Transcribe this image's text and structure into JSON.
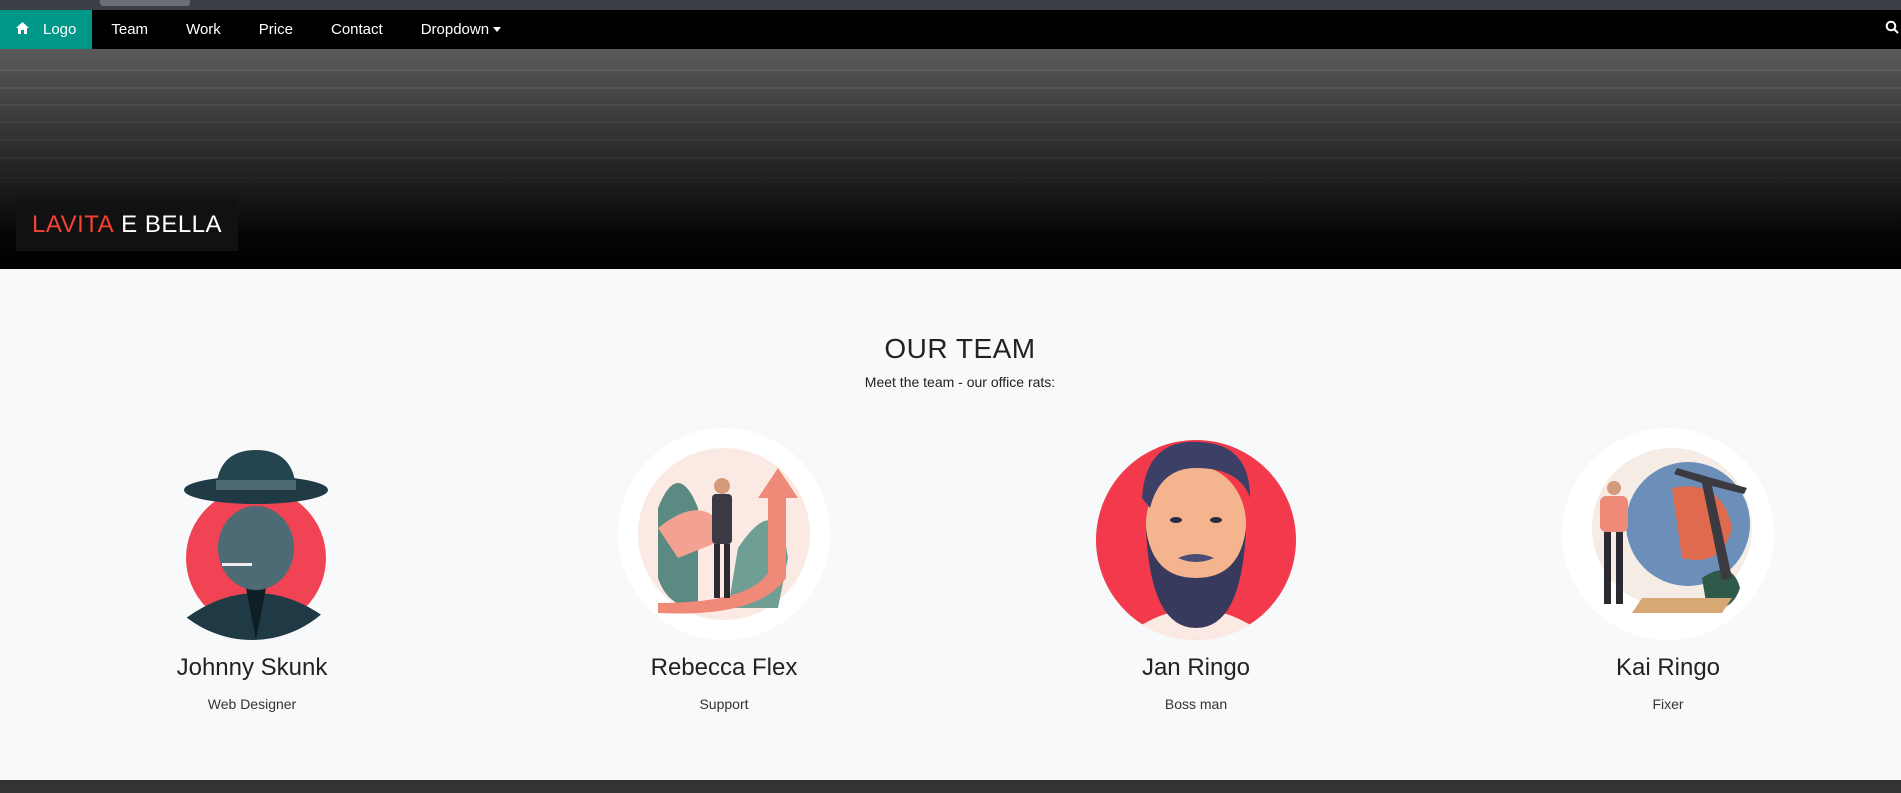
{
  "nav": {
    "logo_label": "Logo",
    "items": [
      "Team",
      "Work",
      "Price",
      "Contact"
    ],
    "dropdown_label": "Dropdown"
  },
  "hero": {
    "brand_red": "LAVITA",
    "brand_white": "E BELLA"
  },
  "team": {
    "title": "OUR TEAM",
    "subtitle": "Meet the team - our office rats:",
    "members": [
      {
        "name": "Johnny Skunk",
        "role": "Web Designer"
      },
      {
        "name": "Rebecca Flex",
        "role": "Support"
      },
      {
        "name": "Jan Ringo",
        "role": "Boss man"
      },
      {
        "name": "Kai Ringo",
        "role": "Fixer"
      }
    ]
  },
  "colors": {
    "accent": "#009688",
    "brand_red": "#f44336",
    "nav_bg": "#000000"
  }
}
